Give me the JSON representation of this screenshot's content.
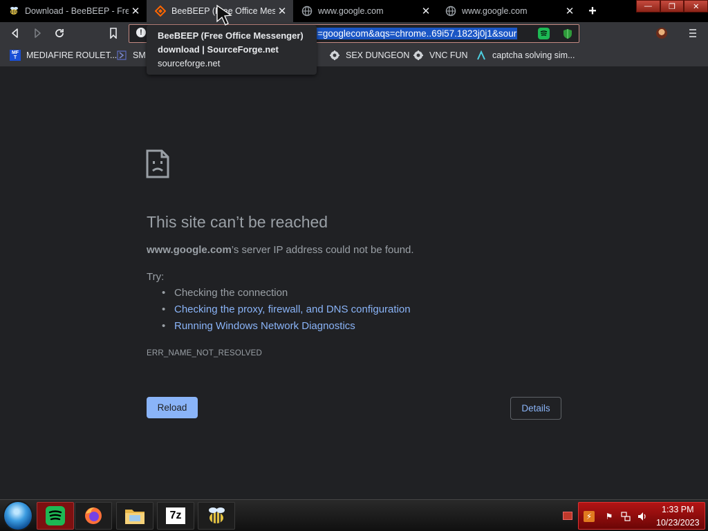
{
  "tabs": [
    {
      "title": "Download - BeeBEEP - Free Office Messenger",
      "favicon": "beebeep-bee-icon",
      "active": false
    },
    {
      "title": "BeeBEEP (Free Office Messenger)",
      "favicon": "sourceforge-icon",
      "active": true
    },
    {
      "title": "www.google.com",
      "favicon": "globe-icon",
      "active": false
    },
    {
      "title": "www.google.com",
      "favicon": "globe-icon",
      "active": false
    }
  ],
  "omnibox": {
    "url_visible": "=googlecom&aqs=chrome..69i57.1823j0j1&sour"
  },
  "tooltip": {
    "title": "BeeBEEP (Free Office Messenger) download | SourceForge.net",
    "domain": "sourceforge.net"
  },
  "bookmarks": [
    {
      "label": "MEDIAFIRE ROULET...",
      "icon": "mediafire-icon"
    },
    {
      "label": "SM",
      "icon": "sigma-icon"
    },
    {
      "label": "SEX DUNGEON",
      "icon": "gear-shield-icon"
    },
    {
      "label": "VNC FUN",
      "icon": "gear-shield-icon"
    },
    {
      "label": "captcha solving sim...",
      "icon": "lambda-icon"
    }
  ],
  "error": {
    "heading": "This site can’t be reached",
    "host": "www.google.com",
    "message_rest": "’s server IP address could not be found.",
    "try_label": "Try:",
    "suggestions": [
      {
        "text": "Checking the connection",
        "link": false
      },
      {
        "text": "Checking the proxy, firewall, and DNS configuration",
        "link": true
      },
      {
        "text": "Running Windows Network Diagnostics",
        "link": true
      }
    ],
    "code": "ERR_NAME_NOT_RESOLVED",
    "reload_label": "Reload",
    "details_label": "Details"
  },
  "taskbar": {
    "apps": [
      {
        "name": "spotify-icon"
      },
      {
        "name": "firefox-icon"
      },
      {
        "name": "file-explorer-icon"
      },
      {
        "name": "7zip-icon",
        "label": "7z"
      },
      {
        "name": "beebeep-bee-icon"
      }
    ],
    "clock": {
      "time": "1:33 PM",
      "date": "10/23/2023"
    }
  },
  "colors": {
    "background": "#202124",
    "link": "#8ab4f8",
    "text_secondary": "#9aa0a6",
    "accent_taskbar": "#b31414"
  }
}
